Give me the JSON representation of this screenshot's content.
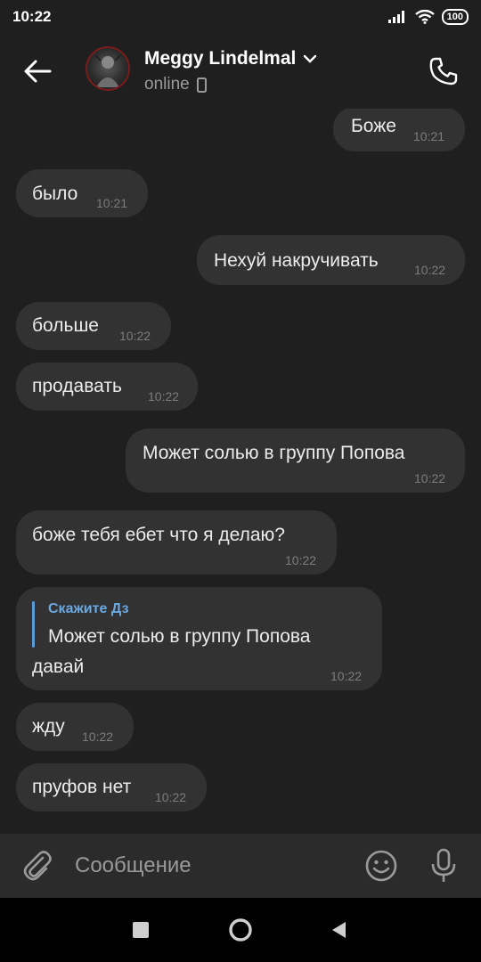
{
  "status_bar": {
    "time": "10:22",
    "battery": "100"
  },
  "header": {
    "name": "Meggy Lindelmal",
    "presence": "online"
  },
  "messages": [
    {
      "side": "out",
      "text": "Боже",
      "time": "10:21"
    },
    {
      "side": "in",
      "text": "было",
      "time": "10:21"
    },
    {
      "side": "out",
      "text": "Нехуй накручивать",
      "time": "10:22"
    },
    {
      "side": "in",
      "text": "больше",
      "time": "10:22"
    },
    {
      "side": "in",
      "text": "продавать",
      "time": "10:22"
    },
    {
      "side": "out",
      "text": "Может солью в группу Попова",
      "time": "10:22"
    },
    {
      "side": "in",
      "text": "боже тебя ебет что я делаю?",
      "time": "10:22"
    },
    {
      "side": "in",
      "reply_author": "Скажите Дз",
      "reply_text": "Может солью в группу Попова",
      "text": "давай",
      "time": "10:22"
    },
    {
      "side": "in",
      "text": "жду",
      "time": "10:22"
    },
    {
      "side": "in",
      "text": "пруфов нет",
      "time": "10:22"
    }
  ],
  "composer": {
    "placeholder": "Сообщение"
  },
  "colors": {
    "background": "#1f1f1f",
    "bubble": "#323233",
    "accent": "#6aa8e0"
  },
  "icons": [
    "back-arrow-icon",
    "chevron-down-icon",
    "phone-device-icon",
    "phone-call-icon",
    "paperclip-icon",
    "emoji-icon",
    "microphone-icon",
    "recents-square-icon",
    "home-circle-icon",
    "back-triangle-icon"
  ]
}
